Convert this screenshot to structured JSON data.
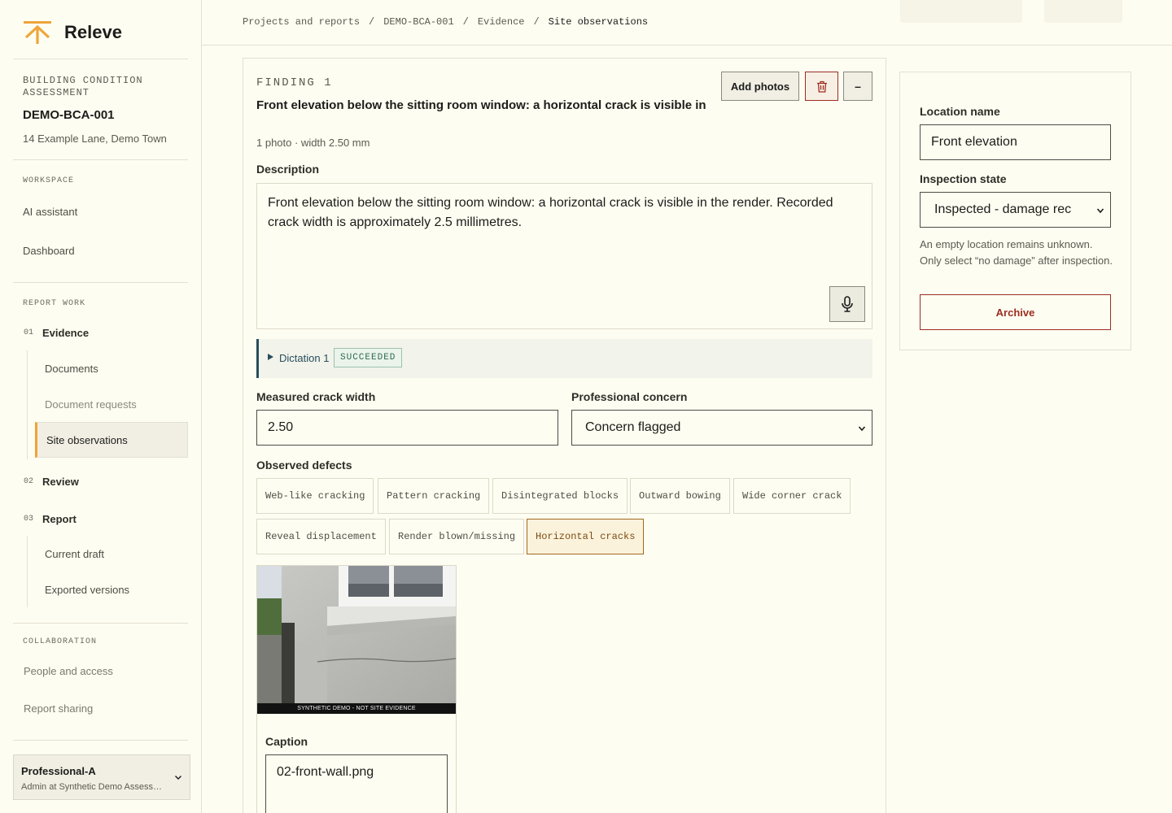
{
  "app": {
    "name": "Releve",
    "logo_icon": "releve-logo-icon",
    "accent": "#eea53a"
  },
  "sidebar": {
    "kicker": "BUILDING CONDITION ASSESSMENT",
    "report_id": "DEMO-BCA-001",
    "address": "14 Example Lane, Demo Town",
    "workspace_heading": "WORKSPACE",
    "workspace_items": [
      "AI assistant",
      "Dashboard"
    ],
    "report_work_heading": "REPORT WORK",
    "sections": [
      {
        "num": "01",
        "label": "Evidence",
        "children": [
          "Documents",
          "Document requests",
          "Site observations"
        ]
      },
      {
        "num": "02",
        "label": "Review"
      },
      {
        "num": "03",
        "label": "Report",
        "children": [
          "Current draft",
          "Exported versions"
        ]
      }
    ],
    "collaboration_heading": "COLLABORATION",
    "collaboration_items": [
      "People and access",
      "Report sharing"
    ],
    "user": {
      "name": "Professional-A",
      "role": "Admin at Synthetic Demo Assessments"
    }
  },
  "breadcrumb": [
    "Projects and reports",
    "DEMO-BCA-001",
    "Evidence",
    "Site observations"
  ],
  "finding": {
    "kicker": "FINDING 1",
    "title": "Front elevation below the sitting room window: a horizontal crack is visible in",
    "meta": "1 photo · width 2.50 mm",
    "add_photos_label": "Add photos",
    "delete_icon": "trash-icon",
    "collapse_label": "–",
    "description_label": "Description",
    "description": "Front elevation below the sitting room window: a horizontal crack is visible in the render. Recorded crack width is approximately 2.5 millimetres.",
    "mic_icon": "microphone-icon",
    "dictation": {
      "label": "Dictation 1",
      "status": "SUCCEEDED",
      "status_color": "#2e6a51"
    },
    "crack_width_label": "Measured crack width",
    "crack_width": "2.50",
    "concern_label": "Professional concern",
    "concern": "Concern flagged",
    "defects_label": "Observed defects",
    "defects": [
      {
        "label": "Web-like cracking",
        "selected": false
      },
      {
        "label": "Pattern cracking",
        "selected": false
      },
      {
        "label": "Disintegrated blocks",
        "selected": false
      },
      {
        "label": "Outward bowing",
        "selected": false
      },
      {
        "label": "Wide corner crack",
        "selected": false
      },
      {
        "label": "Reveal displacement",
        "selected": false
      },
      {
        "label": "Render blown/missing",
        "selected": false
      },
      {
        "label": "Horizontal cracks",
        "selected": true
      }
    ],
    "photo": {
      "banner": "SYNTHETIC DEMO - NOT SITE EVIDENCE",
      "caption_label": "Caption",
      "caption": "02-front-wall.png"
    }
  },
  "location": {
    "name_label": "Location name",
    "name": "Front elevation",
    "state_label": "Inspection state",
    "state": "Inspected - damage rec",
    "help": "An empty location remains unknown. Only select “no damage” after inspection.",
    "archive_label": "Archive",
    "danger_color": "#9b2d21"
  }
}
